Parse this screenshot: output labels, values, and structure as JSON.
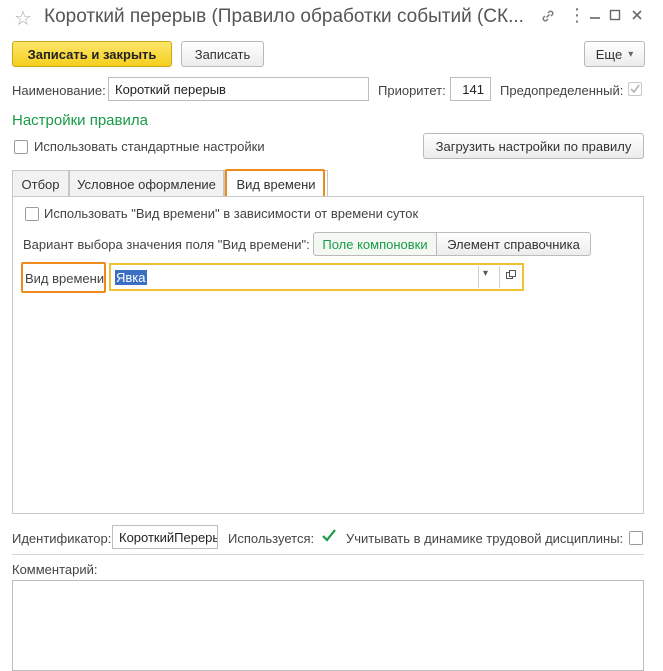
{
  "window": {
    "title": "Короткий перерыв (Правило обработки событий (СК...",
    "link_icon": "link-icon",
    "more_icon": "more-vertical-icon",
    "minimize_icon": "minimize-icon",
    "maximize_icon": "maximize-icon",
    "close_icon": "close-icon"
  },
  "toolbar": {
    "save_close_label": "Записать и закрыть",
    "save_label": "Записать",
    "more_label": "Еще",
    "more_caret": "▾"
  },
  "header": {
    "name_label": "Наименование:",
    "name_value": "Короткий перерыв",
    "priority_label": "Приоритет:",
    "priority_value": "141",
    "predefined_label": "Предопределенный:",
    "predefined_checked": true
  },
  "rule_settings": {
    "section_title": "Настройки правила",
    "use_standard_label": "Использовать стандартные настройки",
    "load_button_label": "Загрузить настройки по правилу"
  },
  "tabs": [
    {
      "label": "Отбор"
    },
    {
      "label": "Условное оформление"
    },
    {
      "label": "Вид времени",
      "active": true
    }
  ],
  "time_tab": {
    "use_by_time_label": "Использовать \"Вид времени\" в зависимости от времени суток",
    "variant_label": "Вариант выбора значения поля \"Вид времени\":",
    "variant_options": [
      "Поле компоновки",
      "Элемент справочника"
    ],
    "variant_selected": "Поле компоновки",
    "time_type_label": "Вид времени",
    "time_type_value": "Явка",
    "dropdown_caret": "▾",
    "open_icon": "open-in-new-icon"
  },
  "footer": {
    "id_label": "Идентификатор:",
    "id_value": "КороткийПерерыв",
    "used_label": "Используется:",
    "used_checked": true,
    "discipline_label": "Учитывать в динамике трудовой дисциплины:",
    "discipline_checked": false,
    "comment_label": "Комментарий:",
    "comment_value": ""
  },
  "colors": {
    "accent_green": "#1a9a48",
    "highlight_orange": "#ef8b1c",
    "primary_yellow": "#f5cf1e",
    "selection_blue": "#3a6fc4"
  }
}
